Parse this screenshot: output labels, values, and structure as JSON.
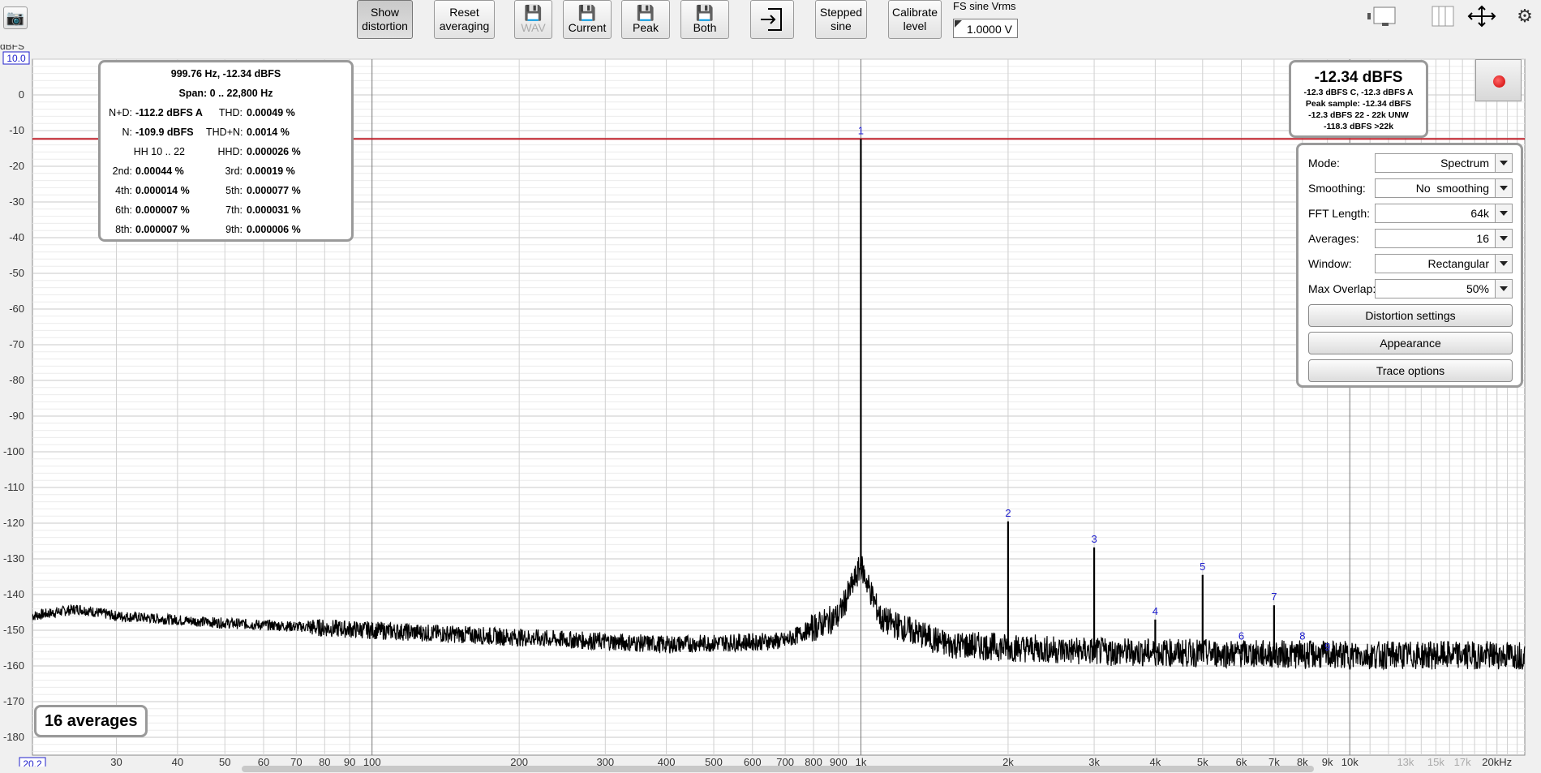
{
  "toolbar": {
    "show_distortion": "Show\ndistortion",
    "reset_averaging": "Reset\naveraging",
    "wav": "WAV",
    "current": "Current",
    "peak": "Peak",
    "both": "Both",
    "stepped_sine": "Stepped\nsine",
    "calibrate_level": "Calibrate\nlevel",
    "fs_sine_label": "FS sine Vrms",
    "fs_sine_value": "1.0000 V"
  },
  "distortion": {
    "title": "999.76 Hz, -12.34 dBFS",
    "span": "Span: 0 .. 22,800 Hz",
    "rows": [
      {
        "k1": "N+D:",
        "v1": "-112.2 dBFS A",
        "k2": "THD:",
        "v2": "0.00049 %"
      },
      {
        "k1": "N:",
        "v1": "-109.9 dBFS",
        "k2": "THD+N:",
        "v2": "0.0014 %"
      },
      {
        "k1": "HH 10 .. 22",
        "v1": "",
        "k2": "HHD:",
        "v2": "0.000026 %"
      },
      {
        "k1": "2nd:",
        "v1": "0.00044 %",
        "k2": "3rd:",
        "v2": "0.00019 %"
      },
      {
        "k1": "4th:",
        "v1": "0.000014 %",
        "k2": "5th:",
        "v2": "0.000077 %"
      },
      {
        "k1": "6th:",
        "v1": "0.000007 %",
        "k2": "7th:",
        "v2": "0.000031 %"
      },
      {
        "k1": "8th:",
        "v1": "0.000007 %",
        "k2": "9th:",
        "v2": "0.000006 %"
      }
    ]
  },
  "level": {
    "main": "-12.34 dBFS",
    "l1": "-12.3 dBFS C, -12.3 dBFS A",
    "l2": "Peak sample: -12.34 dBFS",
    "l3": "-12.3 dBFS 22 - 22k UNW",
    "l4": "-118.3 dBFS >22k"
  },
  "controls": {
    "mode_label": "Mode:",
    "mode_value": "Spectrum",
    "smoothing_label": "Smoothing:",
    "smoothing_value": "No  smoothing",
    "fft_label": "FFT Length:",
    "fft_value": "64k",
    "averages_label": "Averages:",
    "averages_value": "16",
    "window_label": "Window:",
    "window_value": "Rectangular",
    "overlap_label": "Max Overlap:",
    "overlap_value": "50%",
    "distortion_settings": "Distortion settings",
    "appearance": "Appearance",
    "trace_options": "Trace options"
  },
  "averages_box": "16 averages",
  "chart_data": {
    "type": "line",
    "ylabel": "dBFS",
    "ylim": [
      -185,
      10
    ],
    "xlim": [
      20.2,
      22800
    ],
    "x_scale": "log",
    "y_ticks": [
      0,
      -10,
      -20,
      -30,
      -40,
      -50,
      -60,
      -70,
      -80,
      -90,
      -100,
      -110,
      -120,
      -130,
      -140,
      -150,
      -160,
      -170,
      -180
    ],
    "y_top_label": "10.0",
    "x_ticks": [
      {
        "v": 30,
        "l": "30"
      },
      {
        "v": 40,
        "l": "40"
      },
      {
        "v": 50,
        "l": "50"
      },
      {
        "v": 60,
        "l": "60"
      },
      {
        "v": 70,
        "l": "70"
      },
      {
        "v": 80,
        "l": "80"
      },
      {
        "v": 90,
        "l": "90"
      },
      {
        "v": 100,
        "l": "100"
      },
      {
        "v": 200,
        "l": "200"
      },
      {
        "v": 300,
        "l": "300"
      },
      {
        "v": 400,
        "l": "400"
      },
      {
        "v": 500,
        "l": "500"
      },
      {
        "v": 600,
        "l": "600"
      },
      {
        "v": 700,
        "l": "700"
      },
      {
        "v": 800,
        "l": "800"
      },
      {
        "v": 900,
        "l": "900"
      },
      {
        "v": 1000,
        "l": "1k"
      },
      {
        "v": 2000,
        "l": "2k"
      },
      {
        "v": 3000,
        "l": "3k"
      },
      {
        "v": 4000,
        "l": "4k"
      },
      {
        "v": 5000,
        "l": "5k"
      },
      {
        "v": 6000,
        "l": "6k"
      },
      {
        "v": 7000,
        "l": "7k"
      },
      {
        "v": 8000,
        "l": "8k"
      },
      {
        "v": 9000,
        "l": "9k"
      },
      {
        "v": 10000,
        "l": "10k"
      },
      {
        "v": 13000,
        "l": "13k",
        "dim": true
      },
      {
        "v": 15000,
        "l": "15k",
        "dim": true
      },
      {
        "v": 17000,
        "l": "17k",
        "dim": true
      },
      {
        "v": 20000,
        "l": "20kHz"
      }
    ],
    "x_start_label": "20.2",
    "reference_level_db": -12.34,
    "harmonics": [
      {
        "n": "1",
        "f": 999.76,
        "db": -12.34
      },
      {
        "n": "2",
        "f": 2000,
        "db": -119.5
      },
      {
        "n": "3",
        "f": 3000,
        "db": -126.8
      },
      {
        "n": "4",
        "f": 4000,
        "db": -147
      },
      {
        "n": "5",
        "f": 5000,
        "db": -134.5
      },
      {
        "n": "6",
        "f": 6000,
        "db": -154
      },
      {
        "n": "7",
        "f": 7000,
        "db": -143
      },
      {
        "n": "8",
        "f": 8000,
        "db": -154
      },
      {
        "n": "9",
        "f": 9000,
        "db": -157
      }
    ],
    "noise_floor": [
      {
        "f": 20.2,
        "db": -146
      },
      {
        "f": 25,
        "db": -144
      },
      {
        "f": 30,
        "db": -146
      },
      {
        "f": 50,
        "db": -148
      },
      {
        "f": 100,
        "db": -150
      },
      {
        "f": 200,
        "db": -152
      },
      {
        "f": 400,
        "db": -154
      },
      {
        "f": 700,
        "db": -153
      },
      {
        "f": 900,
        "db": -146
      },
      {
        "f": 1000,
        "db": -132
      },
      {
        "f": 1100,
        "db": -147
      },
      {
        "f": 1500,
        "db": -154
      },
      {
        "f": 3000,
        "db": -156
      },
      {
        "f": 10000,
        "db": -157
      },
      {
        "f": 22800,
        "db": -157
      }
    ]
  }
}
